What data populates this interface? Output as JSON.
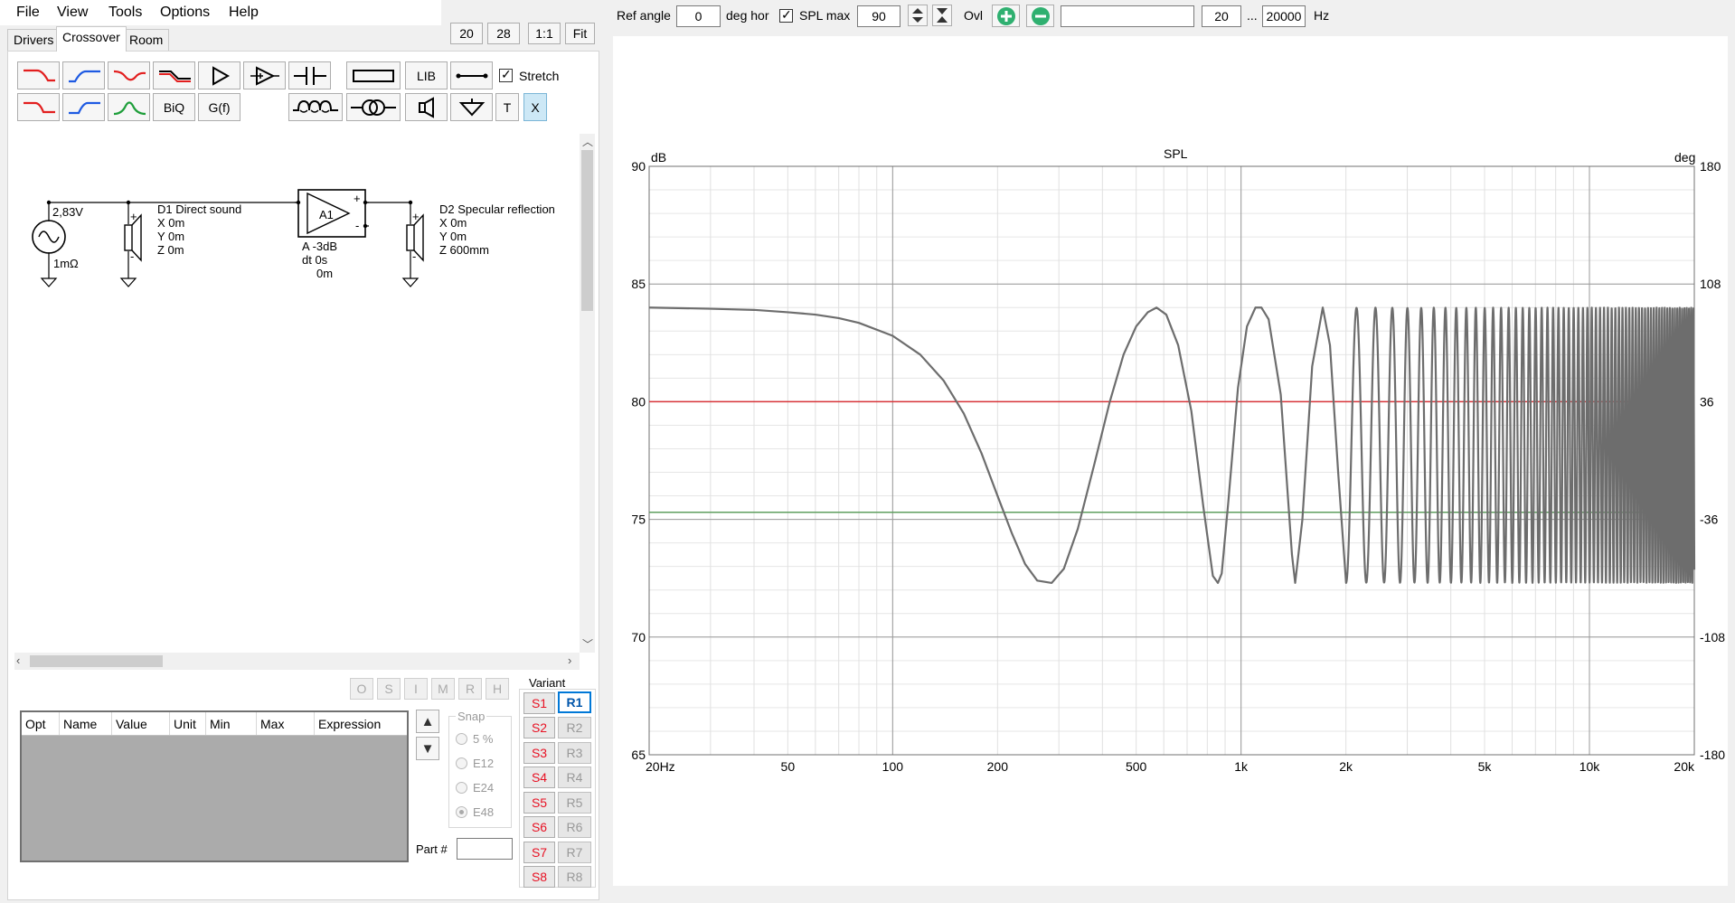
{
  "menu": [
    "File",
    "View",
    "Tools",
    "Options",
    "Help"
  ],
  "tabs": [
    "Drivers",
    "Crossover",
    "Room"
  ],
  "active_tab": "Crossover",
  "top_buttons": [
    "20",
    "28",
    "1:1",
    "Fit"
  ],
  "toolbar": {
    "lib": "LIB",
    "biq": "BiQ",
    "gf": "G(f)",
    "t": "T",
    "x": "X",
    "stretch_label": "Stretch"
  },
  "schematic": {
    "source_voltage": "2,83V",
    "source_resistance": "1mΩ",
    "d1": {
      "name": "D1 Direct sound",
      "x": "X 0m",
      "y": "Y 0m",
      "z": "Z 0m"
    },
    "a1": {
      "name": "A1",
      "gain": "A  -3dB",
      "dt": "dt 0s",
      "dist": "0m"
    },
    "d2": {
      "name": "D2 Specular reflection",
      "x": "X 0m",
      "y": "Y 0m",
      "z": "Z 600mm"
    },
    "plus": "+",
    "minus": "-"
  },
  "flags": [
    "O",
    "S",
    "I",
    "M",
    "R",
    "H"
  ],
  "param_table": {
    "columns": [
      "Opt",
      "Name",
      "Value",
      "Unit",
      "Min",
      "Max",
      "Expression"
    ]
  },
  "snap": {
    "label": "Snap",
    "options": [
      "5 %",
      "E12",
      "E24",
      "E48"
    ],
    "selected": "E48"
  },
  "part_label": "Part #",
  "variant": {
    "label": "Variant",
    "s": [
      "S1",
      "S2",
      "S3",
      "S4",
      "S5",
      "S6",
      "S7",
      "S8"
    ],
    "r": [
      "R1",
      "R2",
      "R3",
      "R4",
      "R5",
      "R6",
      "R7",
      "R8"
    ],
    "active_r": "R1"
  },
  "graph_toolbar": {
    "ref_angle_label": "Ref angle",
    "ref_angle_value": "0",
    "deg_hor": "deg hor",
    "spl_max_label": "SPL max",
    "spl_max_value": "90",
    "ovl": "Ovl",
    "freq_min": "20",
    "ellipsis": "...",
    "freq_max": "20000",
    "hz": "Hz"
  },
  "chart_data": {
    "type": "line",
    "title": "SPL",
    "ylabel_left": "dB",
    "ylabel_right": "deg",
    "x_scale": "log",
    "xlim": [
      20,
      20000
    ],
    "ylim": [
      65,
      90
    ],
    "ylim_right": [
      -180,
      180
    ],
    "x_ticks": [
      "20Hz",
      "50",
      "100",
      "200",
      "500",
      "1k",
      "2k",
      "5k",
      "10k",
      "20k"
    ],
    "x_tick_values": [
      20,
      50,
      100,
      200,
      500,
      1000,
      2000,
      5000,
      10000,
      20000
    ],
    "y_ticks_left": [
      "90",
      "85",
      "80",
      "75",
      "70",
      "65"
    ],
    "y_ticks_right": [
      "180",
      "108",
      "36",
      "-36",
      "-108",
      "-180"
    ],
    "grid": true,
    "series": [
      {
        "color": "#6d6d6d",
        "description": "comb-filter SPL response: direct sound plus -3dB specular reflection, path difference 0.6m",
        "x": [
          20,
          30,
          40,
          50,
          60,
          70,
          80,
          100,
          120,
          140,
          160,
          180,
          200,
          220,
          240,
          260,
          286,
          310,
          340,
          380,
          420,
          460,
          500,
          540,
          572,
          610,
          660,
          720,
          780,
          830,
          858,
          880,
          920,
          980,
          1040,
          1100,
          1144,
          1200,
          1300,
          1400,
          1430,
          1500,
          1600,
          1716,
          1800,
          1900,
          2002
        ],
        "y": [
          84.0,
          83.95,
          83.9,
          83.8,
          83.7,
          83.55,
          83.35,
          82.8,
          82.0,
          80.9,
          79.5,
          77.8,
          76.0,
          74.4,
          73.1,
          72.4,
          72.3,
          72.9,
          74.6,
          77.4,
          80.0,
          82.0,
          83.2,
          83.8,
          84.0,
          83.7,
          82.4,
          79.6,
          75.5,
          72.6,
          72.3,
          72.7,
          75.8,
          80.6,
          83.2,
          84.0,
          84.0,
          83.5,
          80.3,
          73.5,
          72.3,
          75.0,
          81.5,
          84.0,
          82.4,
          77.0,
          72.3
        ]
      },
      {
        "color": "#d9353a",
        "description": "horizontal reference line",
        "x": [
          20,
          20000
        ],
        "y": [
          80.0,
          80.0
        ]
      },
      {
        "color": "#5f9f5f",
        "description": "horizontal reference line",
        "x": [
          20,
          20000
        ],
        "y": [
          75.3,
          75.3
        ]
      }
    ]
  }
}
